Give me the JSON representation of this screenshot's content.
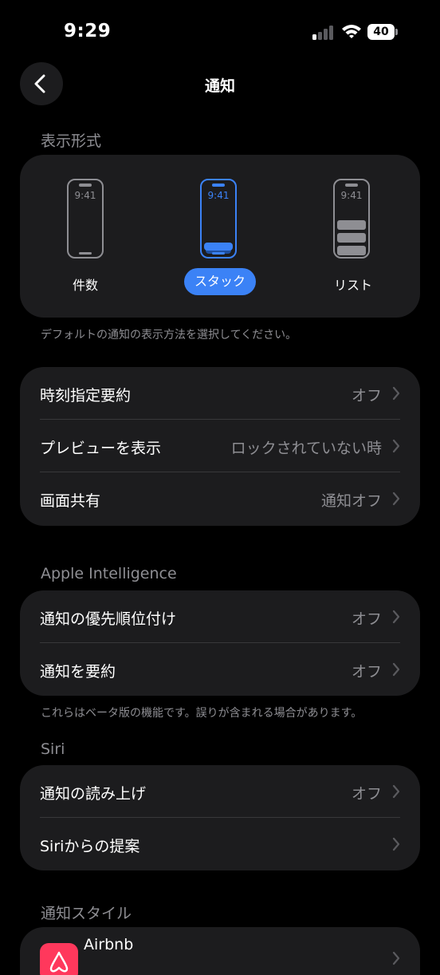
{
  "status_bar": {
    "time": "9:29",
    "battery": "40"
  },
  "nav": {
    "title": "通知"
  },
  "display_style": {
    "section_label": "表示形式",
    "phone_time": "9:41",
    "options": [
      {
        "label": "件数",
        "selected": false
      },
      {
        "label": "スタック",
        "selected": true
      },
      {
        "label": "リスト",
        "selected": false
      }
    ],
    "footnote": "デフォルトの通知の表示方法を選択してください。"
  },
  "general": {
    "rows": [
      {
        "label": "時刻指定要約",
        "value": "オフ"
      },
      {
        "label": "プレビューを表示",
        "value": "ロックされていない時"
      },
      {
        "label": "画面共有",
        "value": "通知オフ"
      }
    ]
  },
  "apple_intelligence": {
    "section_label": "Apple Intelligence",
    "rows": [
      {
        "label": "通知の優先順位付け",
        "value": "オフ"
      },
      {
        "label": "通知を要約",
        "value": "オフ"
      }
    ],
    "footnote": "これらはベータ版の機能です。誤りが含まれる場合があります。"
  },
  "siri": {
    "section_label": "Siri",
    "rows": [
      {
        "label": "通知の読み上げ",
        "value": "オフ"
      },
      {
        "label": "Siriからの提案",
        "value": ""
      }
    ]
  },
  "notification_style": {
    "section_label": "通知スタイル",
    "apps": [
      {
        "label": "Airbnb",
        "icon": "airbnb-icon"
      }
    ]
  },
  "colors": {
    "accent": "#3b82f6",
    "background": "#000000",
    "card": "#1c1c1e",
    "secondary_text": "#8e8e93"
  }
}
